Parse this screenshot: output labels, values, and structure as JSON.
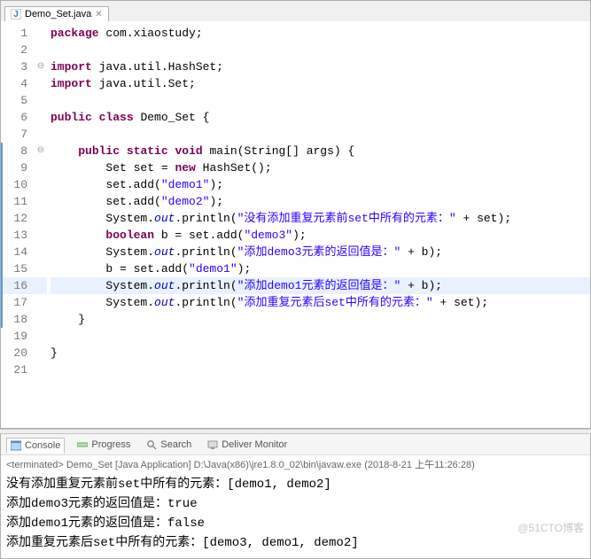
{
  "tab": {
    "filename": "Demo_Set.java"
  },
  "code": {
    "lines": [
      {
        "n": 1,
        "blue": false,
        "fold": "",
        "html": "<span class=\"kw\">package</span> com.xiaostudy;"
      },
      {
        "n": 2,
        "blue": false,
        "fold": "",
        "html": ""
      },
      {
        "n": 3,
        "blue": false,
        "fold": "⊖",
        "html": "<span class=\"kw\">import</span> java.util.HashSet;"
      },
      {
        "n": 4,
        "blue": false,
        "fold": "",
        "html": "<span class=\"kw\">import</span> java.util.Set;"
      },
      {
        "n": 5,
        "blue": false,
        "fold": "",
        "html": ""
      },
      {
        "n": 6,
        "blue": false,
        "fold": "",
        "html": "<span class=\"kw\">public</span> <span class=\"kw\">class</span> Demo_Set {"
      },
      {
        "n": 7,
        "blue": false,
        "fold": "",
        "html": ""
      },
      {
        "n": 8,
        "blue": true,
        "fold": "⊖",
        "html": "    <span class=\"kw\">public</span> <span class=\"kw\">static</span> <span class=\"kw\">void</span> main(String[] args) {"
      },
      {
        "n": 9,
        "blue": true,
        "fold": "",
        "html": "        Set set = <span class=\"kw\">new</span> HashSet();"
      },
      {
        "n": 10,
        "blue": true,
        "fold": "",
        "html": "        set.add(<span class=\"str\">\"demo1\"</span>);"
      },
      {
        "n": 11,
        "blue": true,
        "fold": "",
        "html": "        set.add(<span class=\"str\">\"demo2\"</span>);"
      },
      {
        "n": 12,
        "blue": true,
        "fold": "",
        "html": "        System.<span class=\"fld\">out</span>.println(<span class=\"str\">\"没有添加重复元素前set中所有的元素：\"</span> + set);"
      },
      {
        "n": 13,
        "blue": true,
        "fold": "",
        "html": "        <span class=\"kw\">boolean</span> b = set.add(<span class=\"str\">\"demo3\"</span>);"
      },
      {
        "n": 14,
        "blue": true,
        "fold": "",
        "html": "        System.<span class=\"fld\">out</span>.println(<span class=\"str\">\"添加demo3元素的返回值是：\"</span> + b);"
      },
      {
        "n": 15,
        "blue": true,
        "fold": "",
        "html": "        b = set.add(<span class=\"str\">\"demo1\"</span>);"
      },
      {
        "n": 16,
        "blue": true,
        "fold": "",
        "hl": true,
        "html": "        System.<span class=\"fld\">out</span>.println(<span class=\"str\">\"添加demo1元素的返回值是：\"</span> + b);"
      },
      {
        "n": 17,
        "blue": true,
        "fold": "",
        "html": "        System.<span class=\"fld\">out</span>.println(<span class=\"str\">\"添加重复元素后set中所有的元素：\"</span> + set);"
      },
      {
        "n": 18,
        "blue": true,
        "fold": "",
        "html": "    }"
      },
      {
        "n": 19,
        "blue": false,
        "fold": "",
        "html": ""
      },
      {
        "n": 20,
        "blue": false,
        "fold": "",
        "html": "}"
      },
      {
        "n": 21,
        "blue": false,
        "fold": "",
        "html": ""
      }
    ]
  },
  "views": {
    "console": "Console",
    "progress": "Progress",
    "search": "Search",
    "deliver": "Deliver Monitor"
  },
  "launch": {
    "status": "<terminated>",
    "name": "Demo_Set [Java Application]",
    "path": "D:\\Java(x86)\\jre1.8.0_02\\bin\\javaw.exe",
    "time": "(2018-8-21 上午11:26:28)"
  },
  "output": [
    "没有添加重复元素前set中所有的元素：[demo1, demo2]",
    "添加demo3元素的返回值是：true",
    "添加demo1元素的返回值是：false",
    "添加重复元素后set中所有的元素：[demo3, demo1, demo2]"
  ],
  "watermark": "@51CTO博客"
}
